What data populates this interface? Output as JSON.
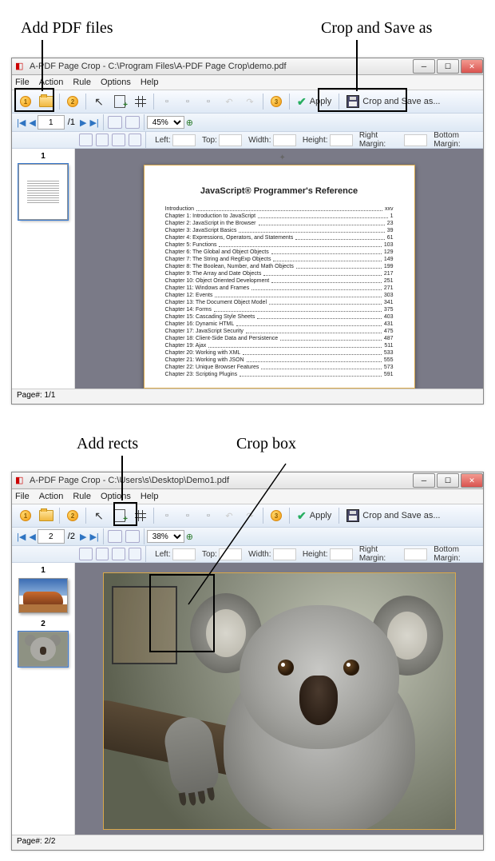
{
  "annotations": {
    "add_pdf": "Add PDF files",
    "crop_save": "Crop and Save as",
    "add_rects": "Add rects",
    "crop_box": "Crop box"
  },
  "app1": {
    "title": "A-PDF Page Crop - C:\\Program Files\\A-PDF Page Crop\\demo.pdf",
    "menu": [
      "File",
      "Action",
      "Rule",
      "Options",
      "Help"
    ],
    "apply": "Apply",
    "crop_and_save": "Crop and Save as...",
    "page_current": "1",
    "page_total": "/1",
    "zoom": "45%",
    "fields": {
      "left": "Left:",
      "top": "Top:",
      "width": "Width:",
      "height": "Height:",
      "right_margin": "Right Margin:",
      "bottom_margin": "Bottom Margin:"
    },
    "thumb_label": "1",
    "doc_title": "JavaScript® Programmer's Reference",
    "toc": [
      {
        "t": "Introduction",
        "p": "xxv"
      },
      {
        "t": "Chapter 1: Introduction to JavaScript",
        "p": "1"
      },
      {
        "t": "Chapter 2: JavaScript in the Browser",
        "p": "23"
      },
      {
        "t": "Chapter 3: JavaScript Basics",
        "p": "39"
      },
      {
        "t": "Chapter 4: Expressions, Operators, and Statements",
        "p": "61"
      },
      {
        "t": "Chapter 5: Functions",
        "p": "103"
      },
      {
        "t": "Chapter 6: The Global and Object Objects",
        "p": "129"
      },
      {
        "t": "Chapter 7: The String and RegExp Objects",
        "p": "149"
      },
      {
        "t": "Chapter 8: The Boolean, Number, and Math Objects",
        "p": "199"
      },
      {
        "t": "Chapter 9: The Array and Date Objects",
        "p": "217"
      },
      {
        "t": "Chapter 10: Object Oriented Development",
        "p": "251"
      },
      {
        "t": "Chapter 11: Windows and Frames",
        "p": "271"
      },
      {
        "t": "Chapter 12: Events",
        "p": "303"
      },
      {
        "t": "Chapter 13: The Document Object Model",
        "p": "341"
      },
      {
        "t": "Chapter 14: Forms",
        "p": "375"
      },
      {
        "t": "Chapter 15: Cascading Style Sheets",
        "p": "403"
      },
      {
        "t": "Chapter 16: Dynamic HTML",
        "p": "431"
      },
      {
        "t": "Chapter 17: JavaScript Security",
        "p": "475"
      },
      {
        "t": "Chapter 18: Client-Side Data and Persistence",
        "p": "487"
      },
      {
        "t": "Chapter 19: Ajax",
        "p": "511"
      },
      {
        "t": "Chapter 20: Working with XML",
        "p": "533"
      },
      {
        "t": "Chapter 21: Working with JSON",
        "p": "555"
      },
      {
        "t": "Chapter 22: Unique Browser Features",
        "p": "573"
      },
      {
        "t": "Chapter 23: Scripting Plugins",
        "p": "591"
      }
    ],
    "status": "Page#: 1/1"
  },
  "app2": {
    "title": "A-PDF Page Crop - C:\\Users\\s\\Desktop\\Demo1.pdf",
    "menu": [
      "File",
      "Action",
      "Rule",
      "Options",
      "Help"
    ],
    "apply": "Apply",
    "crop_and_save": "Crop and Save as...",
    "page_current": "2",
    "page_total": "/2",
    "zoom": "38%",
    "fields": {
      "left": "Left:",
      "top": "Top:",
      "width": "Width:",
      "height": "Height:",
      "right_margin": "Right Margin:",
      "bottom_margin": "Bottom Margin:"
    },
    "thumbs": [
      "1",
      "2"
    ],
    "status": "Page#: 2/2"
  },
  "step_numbers": {
    "one": "1",
    "two": "2",
    "three": "3"
  }
}
